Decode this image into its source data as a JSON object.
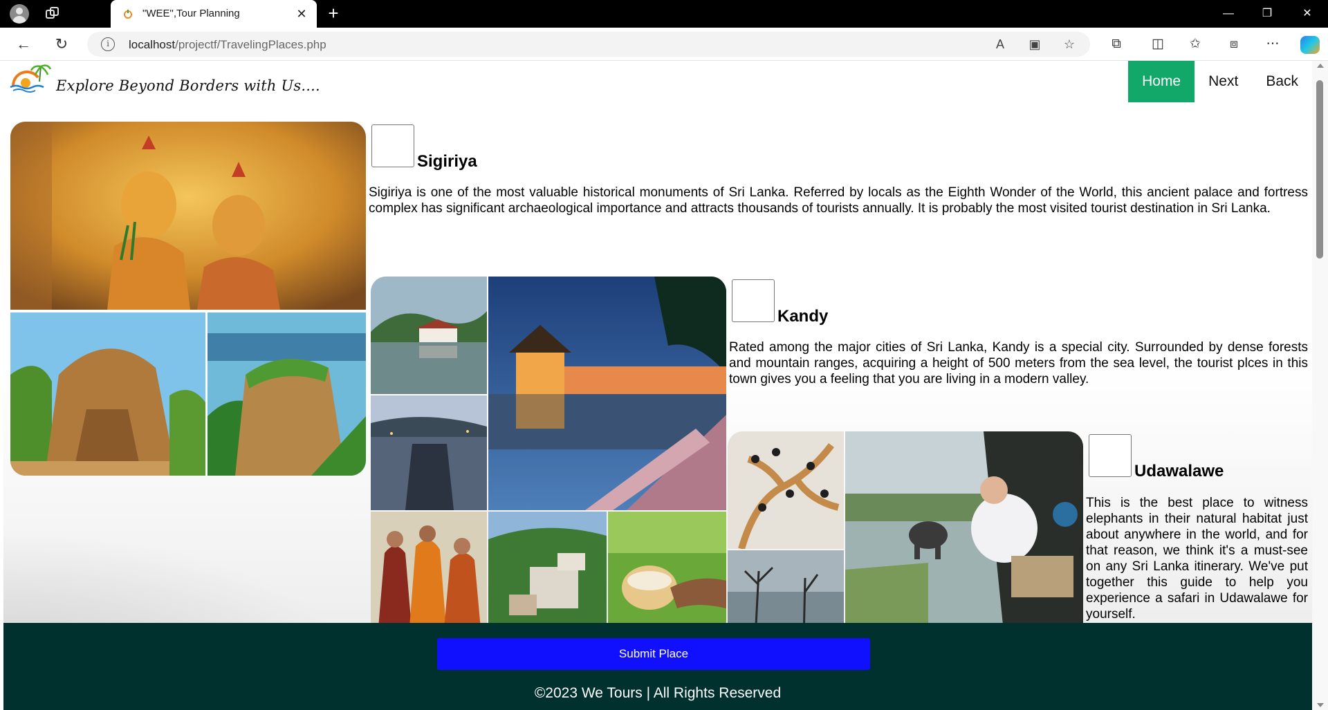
{
  "browser": {
    "tab_title": "\"WEE\",Tour Planning",
    "url_host": "localhost",
    "url_path": "/projectf/TravelingPlaces.php",
    "window_controls": [
      "minimize",
      "restore",
      "close"
    ]
  },
  "site": {
    "tagline": "Explore Beyond Borders with Us....",
    "menu": [
      {
        "label": "Home",
        "active": true
      },
      {
        "label": "Next",
        "active": false
      },
      {
        "label": "Back",
        "active": false
      }
    ]
  },
  "places": [
    {
      "name": "Sigiriya",
      "checked": false,
      "description": "Sigiriya is one of the most valuable historical monuments of Sri Lanka. Referred by locals as the Eighth Wonder of the World, this ancient palace and fortress complex has significant archaeological importance and attracts thousands of tourists annually. It is probably the most visited tourist destination in Sri Lanka."
    },
    {
      "name": "Kandy",
      "checked": false,
      "description": "Rated among the major cities of Sri Lanka, Kandy is a special city. Surrounded by dense forests and mountain ranges, acquiring a height of 500 meters from the sea level, the tourist plces in this town gives you a feeling that you are living in a modern valley."
    },
    {
      "name": "Udawalawe",
      "checked": false,
      "description": "This is the best place to witness elephants in their natural habitat just about anywhere in the world, and for that reason, we think it's a must-see on any Sri Lanka itinerary. We've put together this guide to help you experience a safari in Udawalawe for yourself."
    }
  ],
  "footer": {
    "submit_label": "Submit Place",
    "copyright": "©2023 We Tours | All Rights Reserved"
  },
  "colors": {
    "menu_active": "#11a86a",
    "footer_bg": "#00312e",
    "submit_bg": "#1010ff"
  }
}
